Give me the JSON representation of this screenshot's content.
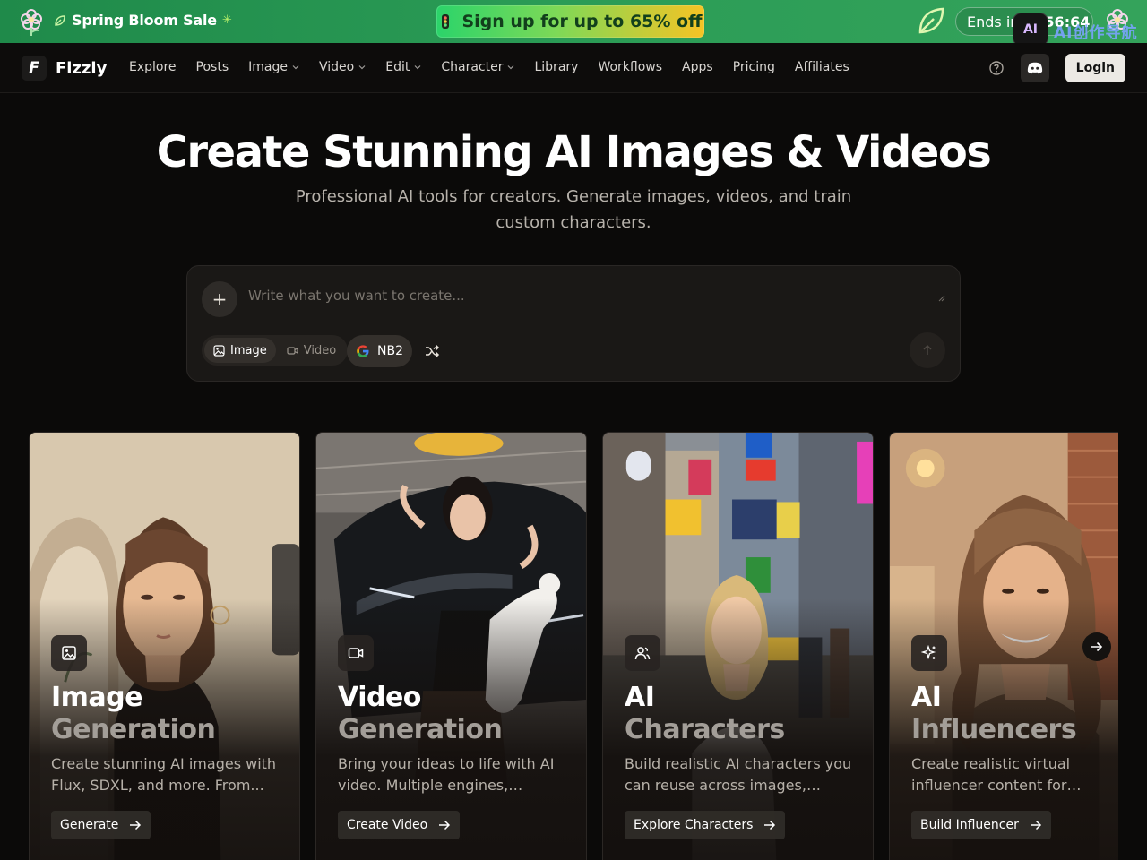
{
  "promo": {
    "sale_label": "Spring Bloom Sale",
    "sparkle": "✳",
    "signup_label": "Sign up for up to 65% off",
    "ends_label": "Ends in",
    "timer": "56:64",
    "ext_badge": "AI",
    "ext_text": "AI创作导航",
    "colors": {
      "banner": "#2b9c56",
      "cta_start": "#2bd46a",
      "cta_end": "#f6c324"
    }
  },
  "nav": {
    "brand": "Fizzly",
    "logo_letter": "F",
    "items": [
      {
        "label": "Explore",
        "dropdown": false
      },
      {
        "label": "Posts",
        "dropdown": false
      },
      {
        "label": "Image",
        "dropdown": true
      },
      {
        "label": "Video",
        "dropdown": true
      },
      {
        "label": "Edit",
        "dropdown": true
      },
      {
        "label": "Character",
        "dropdown": true
      },
      {
        "label": "Library",
        "dropdown": false
      },
      {
        "label": "Workflows",
        "dropdown": false
      },
      {
        "label": "Apps",
        "dropdown": false
      },
      {
        "label": "Pricing",
        "dropdown": false
      },
      {
        "label": "Affiliates",
        "dropdown": false
      }
    ],
    "login_label": "Login",
    "icons": [
      "help-icon",
      "discord-icon"
    ]
  },
  "hero": {
    "title": "Create Stunning AI Images & Videos",
    "subtitle": "Professional AI tools for creators. Generate images, videos, and train custom characters."
  },
  "prompt": {
    "placeholder": "Write what you want to create...",
    "value": "",
    "modes": [
      {
        "label": "Image",
        "icon": "image-icon",
        "active": true
      },
      {
        "label": "Video",
        "icon": "video-icon",
        "active": false
      }
    ],
    "model_label": "NB2",
    "model_icon": "google-icon"
  },
  "cards": [
    {
      "title_1": "Image",
      "title_2": "Generation",
      "icon": "image-icon",
      "description": "Create stunning AI images with Flux, SDXL, and more. From...",
      "cta": "Generate"
    },
    {
      "title_1": "Video",
      "title_2": "Generation",
      "icon": "video-camera-icon",
      "description": "Bring your ideas to life with AI video. Multiple engines, stunnin...",
      "cta": "Create Video"
    },
    {
      "title_1": "AI",
      "title_2": "Characters",
      "icon": "users-icon",
      "description": "Build realistic AI characters you can reuse across images, videos,...",
      "cta": "Explore Characters"
    },
    {
      "title_1": "AI",
      "title_2": "Influencers",
      "icon": "sparkles-icon",
      "description": "Create realistic virtual influencer content for Instagram, TikTok,...",
      "cta": "Build Influencer"
    }
  ]
}
